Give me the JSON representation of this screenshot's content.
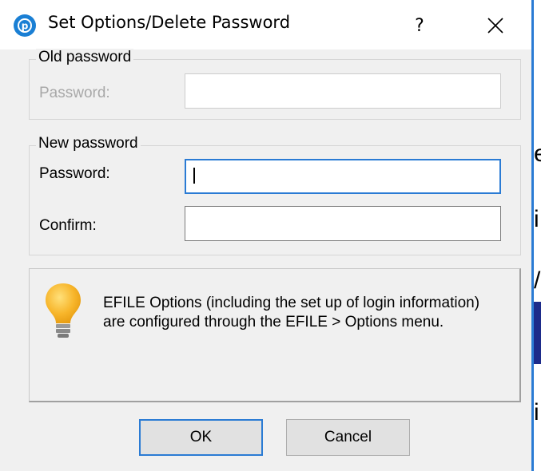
{
  "window": {
    "title": "Set Options/Delete Password",
    "help_label": "?",
    "close_icon": "close-icon",
    "app_icon": "app-logo-icon",
    "accent": "#2a7bd4"
  },
  "old_password": {
    "legend": "Old password",
    "password_label": "Password:",
    "password_value": ""
  },
  "new_password": {
    "legend": "New password",
    "password_label": "Password:",
    "password_value": "",
    "confirm_label": "Confirm:",
    "confirm_value": ""
  },
  "info": {
    "icon": "lightbulb-icon",
    "text": "EFILE Options (including the set up of login information) are configured through the EFILE > Options menu."
  },
  "buttons": {
    "ok_label": "OK",
    "cancel_label": "Cancel"
  },
  "background": {
    "chars": [
      "e",
      "i",
      "/",
      "i"
    ]
  }
}
